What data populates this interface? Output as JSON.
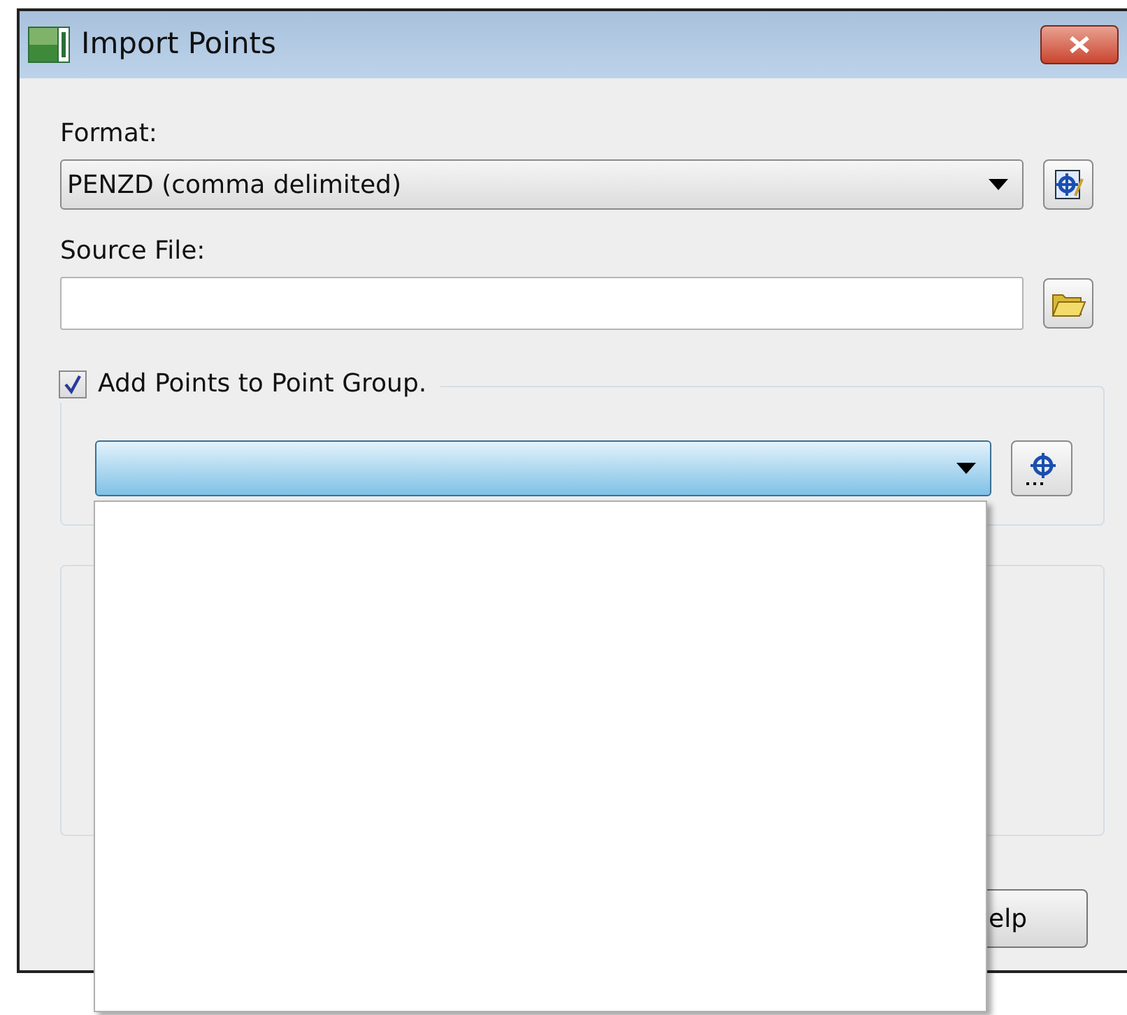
{
  "window": {
    "title": "Import Points"
  },
  "format": {
    "label": "Format:",
    "value": "PENZD (comma delimited)"
  },
  "source_file": {
    "label": "Source File:"
  },
  "point_group": {
    "label": "Add Points to Point Group.",
    "checked": true,
    "expanded": true
  },
  "buttons": [
    {
      "label": "elp"
    }
  ]
}
